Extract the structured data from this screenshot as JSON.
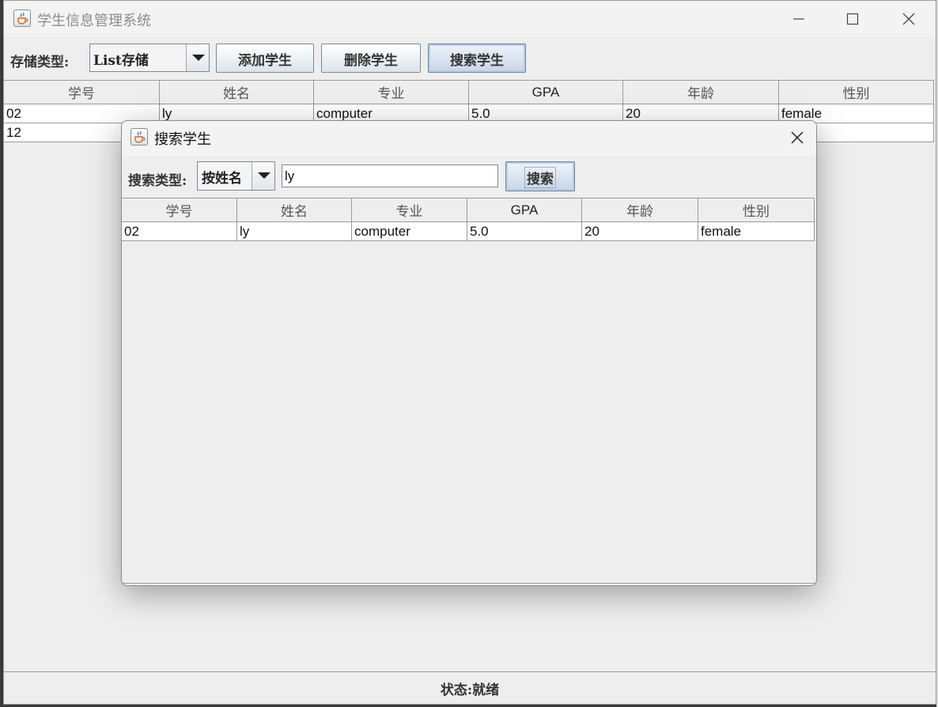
{
  "main": {
    "title": "学生信息管理系统",
    "storage_label": "存储类型:",
    "storage_value": "List存储",
    "buttons": {
      "add": "添加学生",
      "delete": "删除学生",
      "search": "搜索学生"
    },
    "columns": [
      "学号",
      "姓名",
      "专业",
      "GPA",
      "年龄",
      "性别"
    ],
    "rows": [
      [
        "02",
        "ly",
        "computer",
        "5.0",
        "20",
        "female"
      ],
      [
        "12",
        "",
        "",
        "",
        "",
        ""
      ]
    ],
    "status": "状态:就绪"
  },
  "dialog": {
    "title": "搜索学生",
    "search_type_label": "搜索类型:",
    "search_type_value": "按姓名",
    "search_value": "ly",
    "search_button": "搜索",
    "columns": [
      "学号",
      "姓名",
      "专业",
      "GPA",
      "年龄",
      "性别"
    ],
    "rows": [
      [
        "02",
        "ly",
        "computer",
        "5.0",
        "20",
        "female"
      ]
    ]
  },
  "icons": {
    "app": "java-coffee-cup-icon",
    "minimize": "minimize-icon",
    "maximize": "maximize-icon",
    "close": "close-icon",
    "dropdown": "chevron-down-icon"
  }
}
